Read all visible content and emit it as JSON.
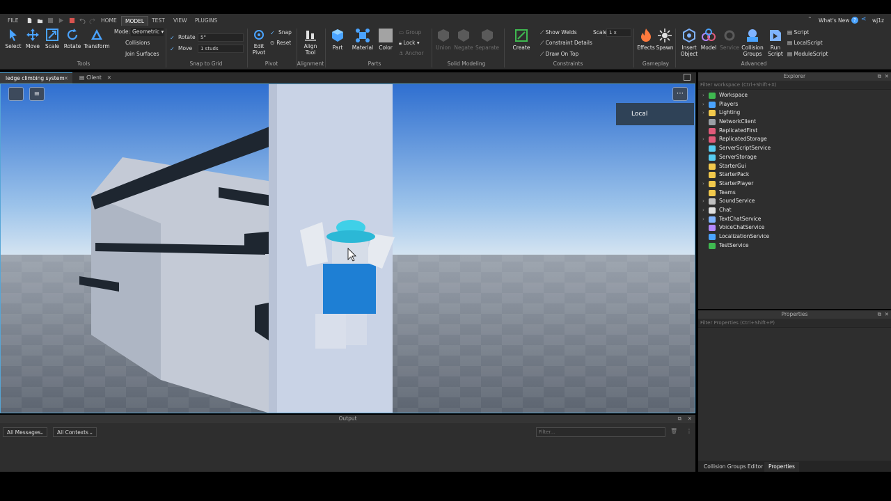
{
  "menu": {
    "tabs": [
      "FILE",
      "HOME",
      "MODEL",
      "TEST",
      "VIEW",
      "PLUGINS"
    ],
    "active_tab": "MODEL",
    "whats_new": "What's New",
    "user": "wj1z"
  },
  "ribbon": {
    "tools": {
      "select": "Select",
      "move": "Move",
      "scale": "Scale",
      "rotate": "Rotate",
      "transform": "Transform",
      "group_label": "Tools"
    },
    "mode": {
      "label": "Mode:",
      "value": "Geometric",
      "collisions": "Collisions",
      "join_surfaces": "Join Surfaces"
    },
    "snap": {
      "rotate": "Rotate",
      "rotate_value": "5°",
      "move": "Move",
      "move_value": "1 studs",
      "group_label": "Snap to Grid"
    },
    "pivot": {
      "edit": "Edit Pivot",
      "snap": "Snap",
      "reset": "Reset",
      "group_label": "Pivot"
    },
    "alignment": {
      "align": "Align Tool",
      "group_label": "Alignment"
    },
    "parts": {
      "part": "Part",
      "material": "Material",
      "color": "Color",
      "group": "Group",
      "lock": "Lock",
      "anchor": "Anchor",
      "group_label": "Parts"
    },
    "solid": {
      "union": "Union",
      "negate": "Negate",
      "separate": "Separate",
      "group_label": "Solid Modeling"
    },
    "constraints": {
      "create": "Create",
      "show_welds": "Show Welds",
      "constraint_details": "Constraint Details",
      "draw_on_top": "Draw On Top",
      "scale_label": "Scale",
      "scale_value": "1 x",
      "group_label": "Constraints"
    },
    "gameplay": {
      "effects": "Effects",
      "spawn": "Spawn",
      "group_label": "Gameplay"
    },
    "advanced": {
      "insert_object": "Insert Object",
      "model": "Model",
      "service": "Service",
      "collision_groups": "Collision Groups",
      "run_script": "Run Script",
      "script": "Script",
      "local_script": "LocalScript",
      "module_script": "ModuleScript",
      "group_label": "Advanced"
    }
  },
  "doc_tabs": [
    "ledge climbing system",
    "Client"
  ],
  "viewport": {
    "local_button": "Local"
  },
  "output": {
    "title": "Output",
    "messages": "All Messages",
    "contexts": "All Contexts",
    "filter_placeholder": "Filter..."
  },
  "explorer": {
    "title": "Explorer",
    "filter": "Filter workspace (Ctrl+Shift+X)",
    "items": [
      {
        "label": "Workspace",
        "expandable": true,
        "color": "#3fb950"
      },
      {
        "label": "Players",
        "expandable": true,
        "color": "#4aa3ff"
      },
      {
        "label": "Lighting",
        "expandable": true,
        "color": "#f2c94c"
      },
      {
        "label": "NetworkClient",
        "expandable": false,
        "color": "#9aa0a6"
      },
      {
        "label": "ReplicatedFirst",
        "expandable": false,
        "color": "#e05a7a"
      },
      {
        "label": "ReplicatedStorage",
        "expandable": true,
        "color": "#e05a7a"
      },
      {
        "label": "ServerScriptService",
        "expandable": false,
        "color": "#56ccf2"
      },
      {
        "label": "ServerStorage",
        "expandable": false,
        "color": "#56ccf2"
      },
      {
        "label": "StarterGui",
        "expandable": false,
        "color": "#f2c94c"
      },
      {
        "label": "StarterPack",
        "expandable": false,
        "color": "#f2c94c"
      },
      {
        "label": "StarterPlayer",
        "expandable": true,
        "color": "#f2c94c"
      },
      {
        "label": "Teams",
        "expandable": false,
        "color": "#f2c94c"
      },
      {
        "label": "SoundService",
        "expandable": true,
        "color": "#c0c0c0"
      },
      {
        "label": "Chat",
        "expandable": true,
        "color": "#e0e0e0"
      },
      {
        "label": "TextChatService",
        "expandable": true,
        "color": "#7fb3ff"
      },
      {
        "label": "VoiceChatService",
        "expandable": false,
        "color": "#b388ff"
      },
      {
        "label": "LocalizationService",
        "expandable": false,
        "color": "#4aa3ff"
      },
      {
        "label": "TestService",
        "expandable": false,
        "color": "#3fb950"
      }
    ]
  },
  "properties": {
    "title": "Properties",
    "filter": "Filter Properties (Ctrl+Shift+P)"
  },
  "bottom_tabs": [
    "Collision Groups Editor",
    "Properties"
  ]
}
